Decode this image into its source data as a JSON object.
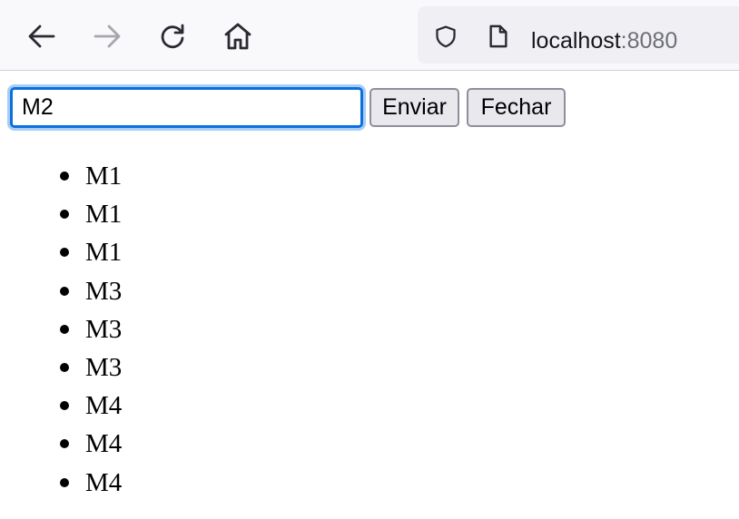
{
  "browser": {
    "url_host": "localhost",
    "url_port": ":8080",
    "icons": {
      "back": "arrow-left-icon",
      "forward": "arrow-right-icon",
      "reload": "reload-icon",
      "home": "home-icon",
      "tracking": "shield-icon",
      "page": "page-icon"
    },
    "forward_enabled": false
  },
  "form": {
    "input_value": "M2",
    "send_label": "Enviar",
    "close_label": "Fechar"
  },
  "messages": [
    "M1",
    "M1",
    "M1",
    "M3",
    "M3",
    "M3",
    "M4",
    "M4",
    "M4"
  ],
  "colors": {
    "focus_ring": "#0b6fe0",
    "toolbar_bg": "#f9f9fb",
    "urlbar_bg": "#f0f0f4"
  }
}
